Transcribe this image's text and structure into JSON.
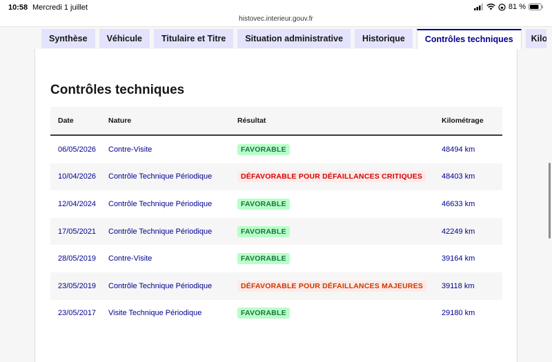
{
  "status_bar": {
    "time": "10:58",
    "date": "Mercredi 1 juillet",
    "battery": "81 %"
  },
  "browser": {
    "url": "histovec.interieur.gouv.fr"
  },
  "tabs": [
    {
      "label": "Synthèse",
      "active": false
    },
    {
      "label": "Véhicule",
      "active": false
    },
    {
      "label": "Titulaire et Titre",
      "active": false
    },
    {
      "label": "Situation administrative",
      "active": false
    },
    {
      "label": "Historique",
      "active": false
    },
    {
      "label": "Contrôles techniques",
      "active": true
    },
    {
      "label": "Kilométrage",
      "active": false
    }
  ],
  "section": {
    "title": "Contrôles techniques",
    "columns": {
      "date": "Date",
      "nature": "Nature",
      "result": "Résultat",
      "mileage": "Kilométrage"
    },
    "rows": [
      {
        "date": "06/05/2026",
        "nature": "Contre-Visite",
        "result": "FAVORABLE",
        "result_type": "fav",
        "mileage": "48494 km"
      },
      {
        "date": "10/04/2026",
        "nature": "Contrôle Technique Périodique",
        "result": "DÉFAVORABLE POUR DÉFAILLANCES CRITIQUES",
        "result_type": "crit",
        "mileage": "48403 km"
      },
      {
        "date": "12/04/2024",
        "nature": "Contrôle Technique Périodique",
        "result": "FAVORABLE",
        "result_type": "fav",
        "mileage": "46633 km"
      },
      {
        "date": "17/05/2021",
        "nature": "Contrôle Technique Périodique",
        "result": "FAVORABLE",
        "result_type": "fav",
        "mileage": "42249 km"
      },
      {
        "date": "28/05/2019",
        "nature": "Contre-Visite",
        "result": "FAVORABLE",
        "result_type": "fav",
        "mileage": "39164 km"
      },
      {
        "date": "23/05/2019",
        "nature": "Contrôle Technique Périodique",
        "result": "DÉFAVORABLE POUR DÉFAILLANCES MAJEURES",
        "result_type": "maj",
        "mileage": "39118 km"
      },
      {
        "date": "23/05/2017",
        "nature": "Visite Technique Périodique",
        "result": "FAVORABLE",
        "result_type": "fav",
        "mileage": "29180 km"
      }
    ]
  },
  "colors": {
    "accent": "#000091",
    "favorable": "#18753c",
    "critical": "#ce0500",
    "major": "#c43a00"
  }
}
